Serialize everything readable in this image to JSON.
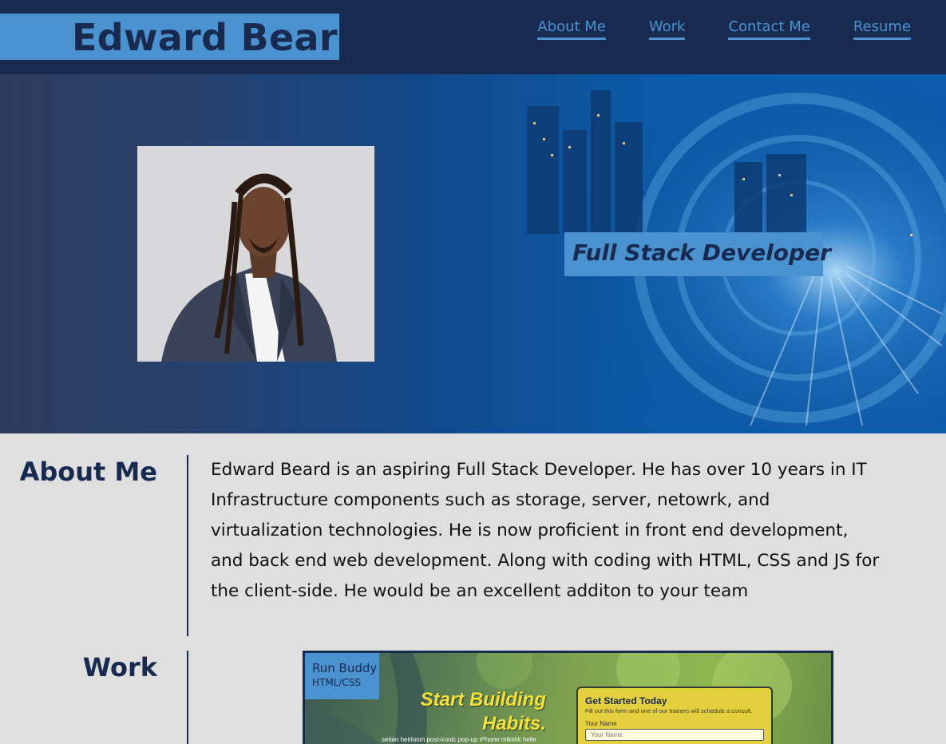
{
  "header": {
    "brand": "Edward Beard",
    "nav": [
      {
        "label": "About Me"
      },
      {
        "label": "Work"
      },
      {
        "label": "Contact Me"
      },
      {
        "label": "Resume"
      }
    ]
  },
  "hero": {
    "tagline": "Full Stack Developer"
  },
  "about": {
    "title": "About Me",
    "text": "Edward Beard is an aspiring Full Stack Developer. He has over 10 years in IT Infrastructure components such as storage, server, netowrk, and virtualization technologies. He is now proficient in front end development, and back end web development. Along with coding with HTML, CSS and JS for the client-side. He would be an excellent additon to your team"
  },
  "work": {
    "title": "Work",
    "projects": [
      {
        "name": "Run Buddy",
        "tech": "HTML/CSS",
        "headline_line1": "Start Building",
        "headline_line2": "Habits.",
        "subtext": "seitan heirloom post-ironic pop-up iPhone mikshk helle",
        "form_title": "Get Started Today",
        "form_desc": "Fill out this form and one of our trainers will schedule a consult.",
        "form_label": "Your Name",
        "form_placeholder": "Your Name"
      }
    ]
  },
  "colors": {
    "navy": "#182a4f",
    "accent": "#4a93d0",
    "page_bg": "#dfdfdf",
    "headline_yellow": "#f4e13a"
  }
}
